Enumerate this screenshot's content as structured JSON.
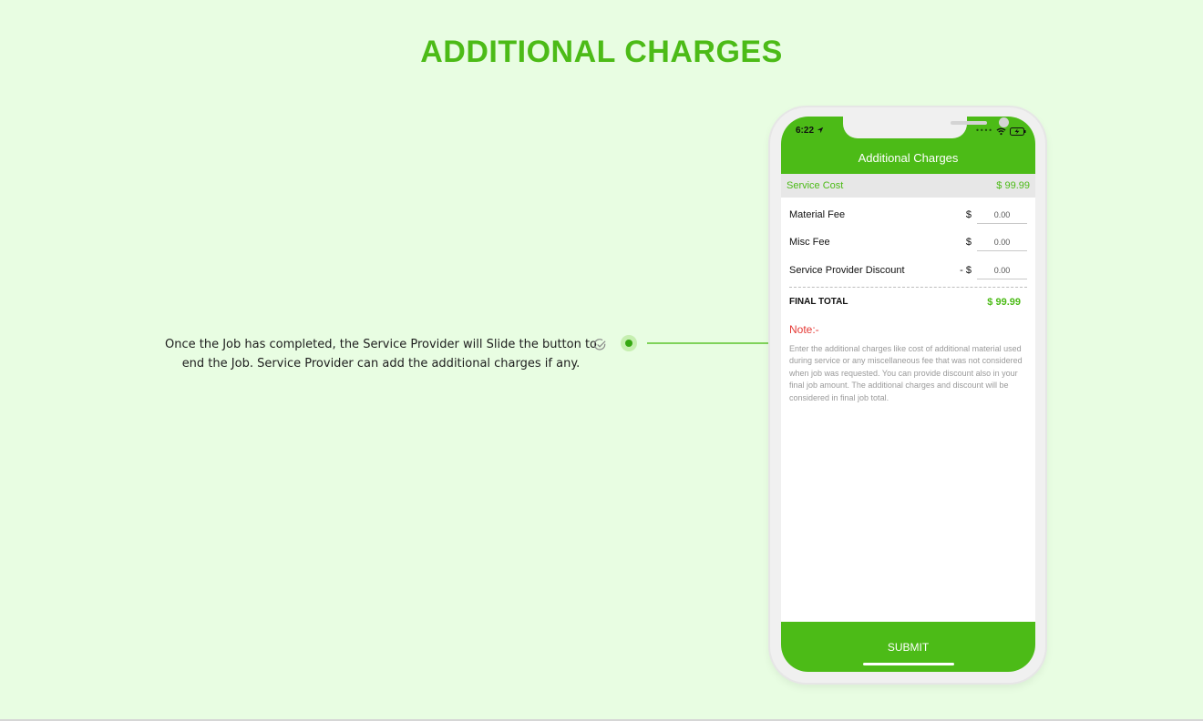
{
  "page": {
    "title": "ADDITIONAL CHARGES",
    "description": "Once the Job has completed, the Service Provider will Slide the button to end the Job. Service Provider can add the additional charges if any."
  },
  "colors": {
    "background": "#e8fde2",
    "accent": "#4cbb17",
    "note": "#e53935"
  },
  "phone": {
    "status_bar": {
      "time": "6:22",
      "icons": [
        "location-arrow-icon",
        "signal-dots-icon",
        "wifi-icon",
        "battery-charging-icon"
      ]
    },
    "app": {
      "title": "Additional Charges",
      "service_cost": {
        "label": "Service Cost",
        "value": "$ 99.99"
      },
      "fees": [
        {
          "label": "Material Fee",
          "currency": "$",
          "value": "0.00"
        },
        {
          "label": "Misc Fee",
          "currency": "$",
          "value": "0.00"
        },
        {
          "label": "Service Provider Discount",
          "currency": "- $",
          "value": "0.00"
        }
      ],
      "final_total": {
        "label": "FINAL TOTAL",
        "value": "$ 99.99"
      },
      "note_label": "Note:-",
      "note_text": "Enter the additional charges like cost of additional material used during service or any miscellaneous fee that was not considered when job was requested. You can provide discount also in your final job amount. The additional charges and discount will be considered in final job total.",
      "submit_label": "SUBMIT"
    }
  }
}
